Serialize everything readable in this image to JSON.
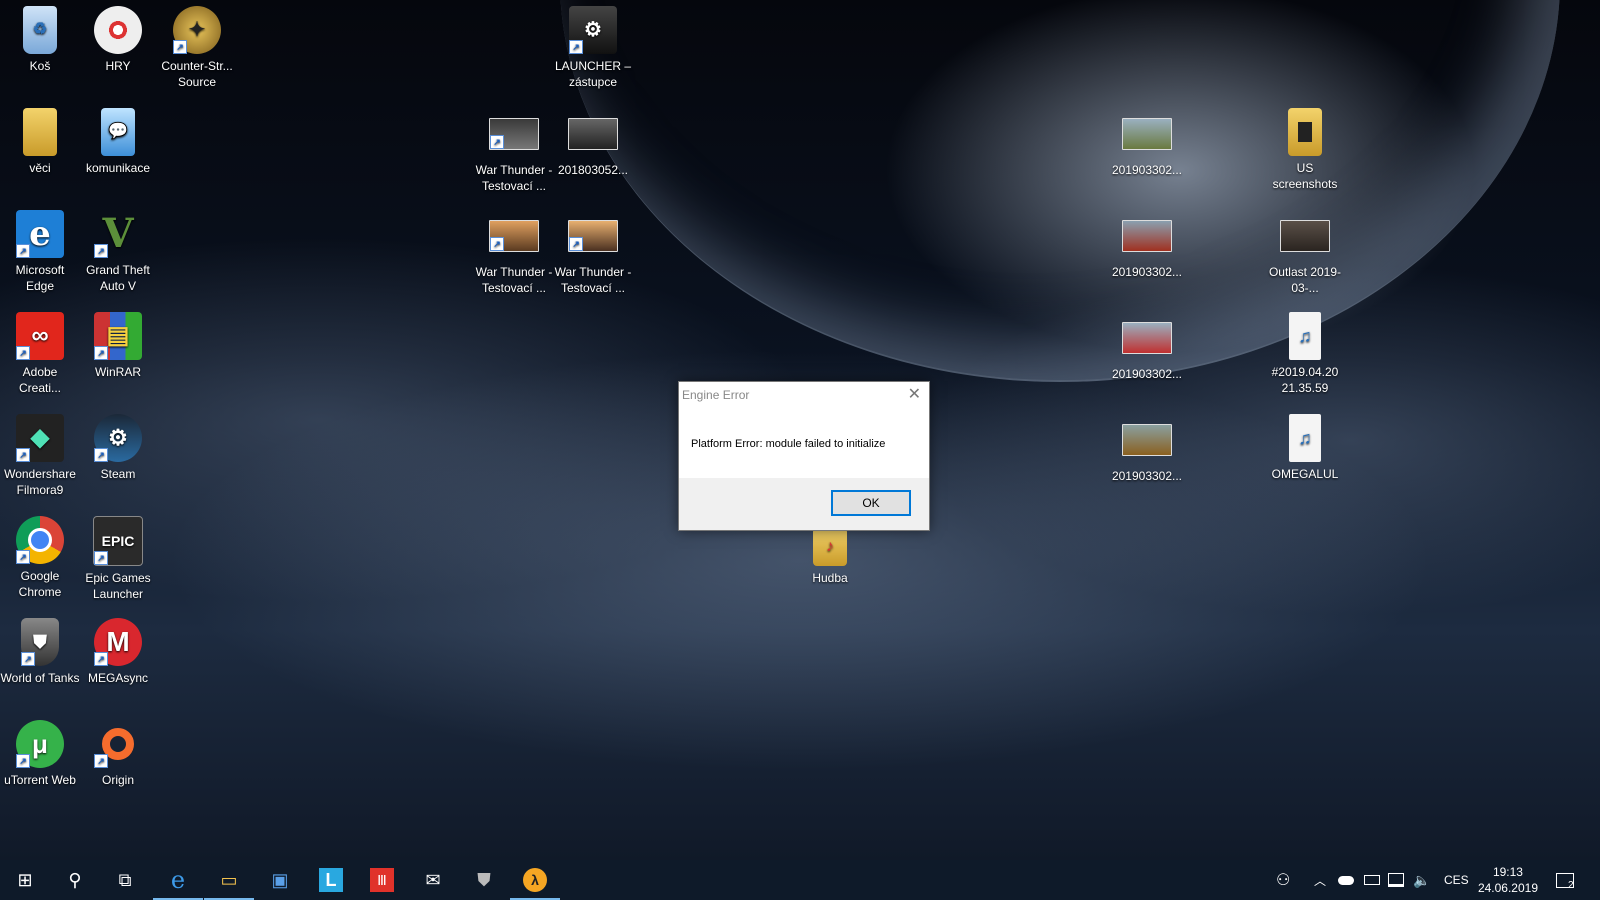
{
  "desktop_icons": [
    {
      "label": "Koš",
      "icon": "recycle-bin-icon"
    },
    {
      "label": "HRY",
      "icon": "disc-icon"
    },
    {
      "label": "Counter-Str... Source",
      "icon": "counter-strike-icon"
    },
    {
      "label": "LAUNCHER – zástupce",
      "icon": "steam-launcher-icon"
    },
    {
      "label": "věci",
      "icon": "folder-icon"
    },
    {
      "label": "komunikace",
      "icon": "chat-computer-icon"
    },
    {
      "label": "War Thunder - Testovací ...",
      "icon": "video-thumbnail-icon"
    },
    {
      "label": "201803052...",
      "icon": "image-thumbnail-icon"
    },
    {
      "label": "201903302...",
      "icon": "image-thumbnail-icon"
    },
    {
      "label": "US screenshots",
      "icon": "folder-icon"
    },
    {
      "label": "Microsoft Edge",
      "icon": "edge-icon"
    },
    {
      "label": "Grand Theft Auto V",
      "icon": "gta-icon"
    },
    {
      "label": "War Thunder - Testovací ...",
      "icon": "video-thumbnail-icon"
    },
    {
      "label": "War Thunder - Testovací ...",
      "icon": "video-thumbnail-icon"
    },
    {
      "label": "201903302...",
      "icon": "image-thumbnail-icon"
    },
    {
      "label": "Outlast 2019-03-...",
      "icon": "video-thumbnail-icon"
    },
    {
      "label": "Adobe Creati...",
      "icon": "adobe-cc-icon"
    },
    {
      "label": "WinRAR",
      "icon": "winrar-icon"
    },
    {
      "label": "201903302...",
      "icon": "image-thumbnail-icon"
    },
    {
      "label": "#2019.04.20 21.35.59",
      "icon": "audio-file-icon"
    },
    {
      "label": "Wondershare Filmora9",
      "icon": "filmora-icon"
    },
    {
      "label": "Steam",
      "icon": "steam-icon"
    },
    {
      "label": "201903302...",
      "icon": "image-thumbnail-icon"
    },
    {
      "label": "OMEGALUL",
      "icon": "audio-file-icon"
    },
    {
      "label": "Hudba",
      "icon": "music-folder-icon"
    },
    {
      "label": "Google Chrome",
      "icon": "chrome-icon"
    },
    {
      "label": "Epic Games Launcher",
      "icon": "epic-games-icon"
    },
    {
      "label": "World of Tanks",
      "icon": "world-of-tanks-icon"
    },
    {
      "label": "MEGAsync",
      "icon": "mega-icon"
    },
    {
      "label": "uTorrent Web",
      "icon": "utorrent-icon"
    },
    {
      "label": "Origin",
      "icon": "origin-icon"
    }
  ],
  "icon_glyphs": {
    "epic": "EPIC",
    "mega": "M",
    "gta": "V",
    "edge": "e",
    "winrar": "▤",
    "utorrent": "μ"
  },
  "dialog": {
    "title": "Engine Error",
    "close": "✕",
    "message": "Platform Error: module failed to initialize",
    "ok_label": "OK"
  },
  "taskbar": {
    "start": "⊞",
    "search": "⚲",
    "taskview": "⧉",
    "apps": [
      {
        "name": "edge",
        "glyph": "e"
      },
      {
        "name": "file-explorer",
        "glyph": "▭"
      },
      {
        "name": "store",
        "glyph": "▣"
      },
      {
        "name": "l-app",
        "glyph": "L"
      },
      {
        "name": "red-app",
        "glyph": "Ⅲ"
      },
      {
        "name": "mail",
        "glyph": "✉"
      },
      {
        "name": "world-of-tanks",
        "glyph": "⛊"
      },
      {
        "name": "half-life",
        "glyph": "λ"
      }
    ],
    "tray": {
      "people": "⚇",
      "chevron": "︿",
      "language": "CES",
      "time": "19:13",
      "date": "24.06.2019",
      "notifications_count": "2"
    }
  },
  "colors": {
    "dialog_ok_border": "#0078d7",
    "taskbar": "#0e1a29",
    "active_indicator": "#76b9ed"
  }
}
